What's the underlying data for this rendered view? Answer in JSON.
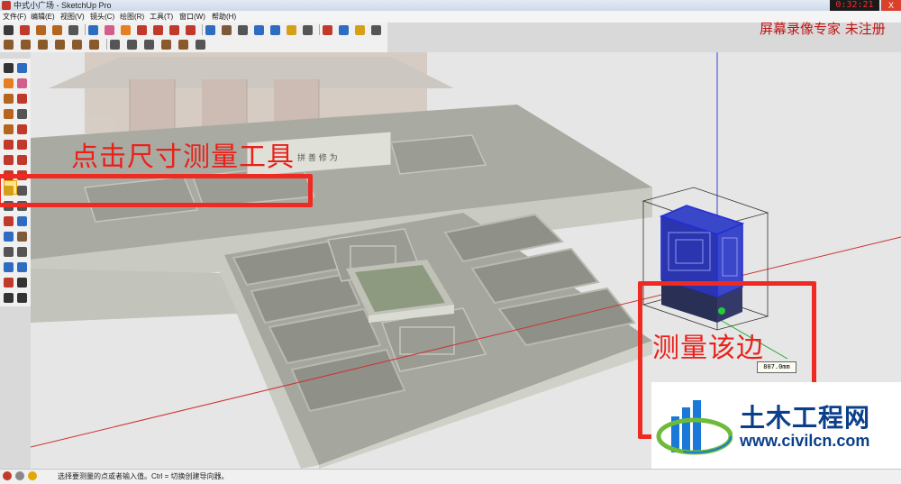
{
  "window": {
    "title": "中式小广场 - SketchUp Pro",
    "close_label": "X"
  },
  "recorder": {
    "timer": "0:32:21",
    "watermark": "屏幕录像专家 未注册"
  },
  "menu": [
    {
      "label": "文件(F)"
    },
    {
      "label": "编辑(E)"
    },
    {
      "label": "视图(V)"
    },
    {
      "label": "镜头(C)"
    },
    {
      "label": "绘图(R)"
    },
    {
      "label": "工具(T)"
    },
    {
      "label": "窗口(W)"
    },
    {
      "label": "帮助(H)"
    }
  ],
  "toolbar_icons": [
    {
      "name": "select-icon",
      "color": "#3a3a3a"
    },
    {
      "name": "pencil-icon",
      "color": "#c0392b"
    },
    {
      "name": "rectangle-icon",
      "color": "#b5651d"
    },
    {
      "name": "circle-icon",
      "color": "#b5651d"
    },
    {
      "name": "arc-icon",
      "color": "#555"
    },
    {
      "name": "make-component-icon",
      "color": "#2d6cc0"
    },
    {
      "name": "eraser-icon",
      "color": "#d35d8b"
    },
    {
      "name": "paint-bucket-icon",
      "color": "#e67e22"
    },
    {
      "name": "push-pull-icon",
      "color": "#c0392b"
    },
    {
      "name": "move-icon",
      "color": "#c0392b"
    },
    {
      "name": "rotate-icon",
      "color": "#c0392b"
    },
    {
      "name": "offset-icon",
      "color": "#c0392b"
    },
    {
      "name": "orbit-icon",
      "color": "#2d6cc0"
    },
    {
      "name": "pan-icon",
      "color": "#7f5a3a"
    },
    {
      "name": "zoom-icon",
      "color": "#555"
    },
    {
      "name": "zoom-extents-icon",
      "color": "#2d6cc0"
    },
    {
      "name": "previous-view-icon",
      "color": "#2d6cc0"
    },
    {
      "name": "tape-measure-icon",
      "color": "#d4a017"
    },
    {
      "name": "text-icon",
      "color": "#555"
    },
    {
      "name": "axes-icon",
      "color": "#c0392b"
    },
    {
      "name": "3d-text-icon",
      "color": "#2d6cc0"
    },
    {
      "name": "warehouse-icon",
      "color": "#d4a017"
    },
    {
      "name": "extension-icon",
      "color": "#555"
    }
  ],
  "toolbar_row2_icons": [
    {
      "name": "iso-view-icon",
      "color": "#8a5a2b"
    },
    {
      "name": "top-view-icon",
      "color": "#8a5a2b"
    },
    {
      "name": "front-view-icon",
      "color": "#8a5a2b"
    },
    {
      "name": "right-view-icon",
      "color": "#8a5a2b"
    },
    {
      "name": "back-view-icon",
      "color": "#8a5a2b"
    },
    {
      "name": "left-view-icon",
      "color": "#8a5a2b"
    },
    {
      "name": "xray-icon",
      "color": "#555"
    },
    {
      "name": "wireframe-icon",
      "color": "#555"
    },
    {
      "name": "hidden-line-icon",
      "color": "#555"
    },
    {
      "name": "shaded-icon",
      "color": "#8a5a2b"
    },
    {
      "name": "shaded-textures-icon",
      "color": "#8a5a2b"
    },
    {
      "name": "monochrome-icon",
      "color": "#555"
    }
  ],
  "palette_icons": [
    {
      "name": "select-tool-icon",
      "color": "#333"
    },
    {
      "name": "component-tool-icon",
      "color": "#2d6cc0"
    },
    {
      "name": "paint-tool-icon",
      "color": "#e67e22"
    },
    {
      "name": "eraser-tool-icon",
      "color": "#d35d8b"
    },
    {
      "name": "rectangle-tool-icon",
      "color": "#b5651d"
    },
    {
      "name": "line-tool-icon",
      "color": "#c0392b"
    },
    {
      "name": "circle-tool-icon",
      "color": "#b5651d"
    },
    {
      "name": "arc-tool-icon",
      "color": "#555"
    },
    {
      "name": "polygon-tool-icon",
      "color": "#b5651d"
    },
    {
      "name": "freehand-tool-icon",
      "color": "#c0392b"
    },
    {
      "name": "move-tool-icon",
      "color": "#c0392b"
    },
    {
      "name": "pushpull-tool-icon",
      "color": "#c0392b"
    },
    {
      "name": "rotate-tool-icon",
      "color": "#c0392b"
    },
    {
      "name": "followme-tool-icon",
      "color": "#c0392b"
    },
    {
      "name": "scale-tool-icon",
      "color": "#c0392b"
    },
    {
      "name": "offset-tool-icon",
      "color": "#c0392b"
    },
    {
      "name": "tape-tool-icon",
      "color": "#d4a017"
    },
    {
      "name": "dimension-tool-icon",
      "color": "#555"
    },
    {
      "name": "protractor-tool-icon",
      "color": "#555"
    },
    {
      "name": "text-tool-icon",
      "color": "#555"
    },
    {
      "name": "axes-tool-icon",
      "color": "#c0392b"
    },
    {
      "name": "3dtext-tool-icon",
      "color": "#2d6cc0"
    },
    {
      "name": "orbit-tool-icon",
      "color": "#2d6cc0"
    },
    {
      "name": "pan-tool-icon",
      "color": "#7f5a3a"
    },
    {
      "name": "zoom-tool-icon",
      "color": "#555"
    },
    {
      "name": "zoomwindow-tool-icon",
      "color": "#555"
    },
    {
      "name": "zoomext-tool-icon",
      "color": "#2d6cc0"
    },
    {
      "name": "prevview-tool-icon",
      "color": "#2d6cc0"
    },
    {
      "name": "position-camera-icon",
      "color": "#c0392b"
    },
    {
      "name": "walk-tool-icon",
      "color": "#333"
    },
    {
      "name": "lookaround-tool-icon",
      "color": "#333"
    },
    {
      "name": "section-tool-icon",
      "color": "#333"
    }
  ],
  "annotations": {
    "label_1": "点击尺寸测量工具",
    "label_2": "测量该边"
  },
  "viewport": {
    "plaque_text": "拼 善 修 为",
    "measure_value": "807.0mm"
  },
  "status": {
    "text": "选择要测量的点或者输入值。Ctrl = 切换创建导向器。"
  },
  "logo": {
    "title": "土木工程网",
    "url": "www.civilcn.com"
  },
  "colors": {
    "highlight_red": "#ee2a22",
    "selection_blue": "#1f2fd6"
  }
}
